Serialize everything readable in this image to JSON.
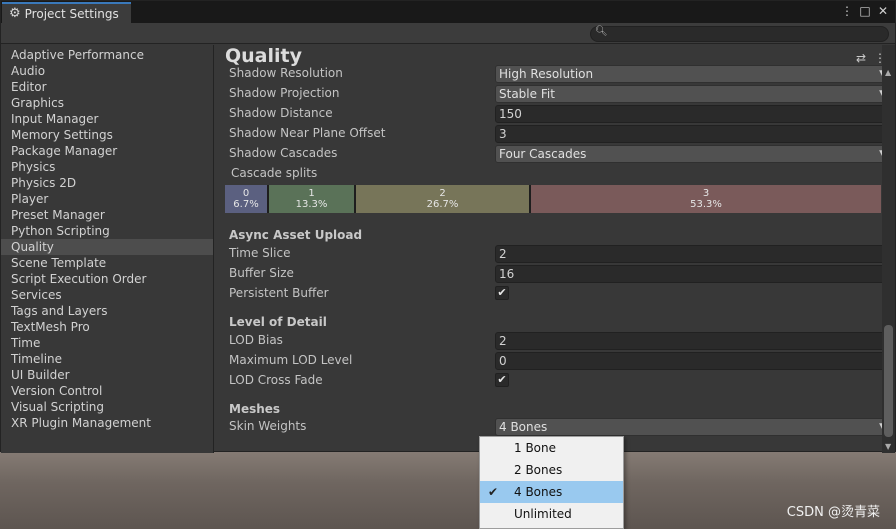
{
  "window": {
    "title": "Project Settings",
    "controls": [
      "⋮",
      "□",
      "✕"
    ]
  },
  "search": {
    "placeholder": ""
  },
  "sidebar": {
    "items": [
      {
        "label": "Adaptive Performance"
      },
      {
        "label": "Audio"
      },
      {
        "label": "Editor"
      },
      {
        "label": "Graphics"
      },
      {
        "label": "Input Manager"
      },
      {
        "label": "Memory Settings"
      },
      {
        "label": "Package Manager"
      },
      {
        "label": "Physics"
      },
      {
        "label": "Physics 2D"
      },
      {
        "label": "Player"
      },
      {
        "label": "Preset Manager"
      },
      {
        "label": "Python Scripting"
      },
      {
        "label": "Quality",
        "selected": true
      },
      {
        "label": "Scene Template"
      },
      {
        "label": "Script Execution Order"
      },
      {
        "label": "Services"
      },
      {
        "label": "Tags and Layers"
      },
      {
        "label": "TextMesh Pro"
      },
      {
        "label": "Time"
      },
      {
        "label": "Timeline"
      },
      {
        "label": "UI Builder"
      },
      {
        "label": "Version Control"
      },
      {
        "label": "Visual Scripting"
      },
      {
        "label": "XR Plugin Management"
      }
    ]
  },
  "page": {
    "title": "Quality",
    "shadows": {
      "resolution_label": "Shadow Resolution",
      "resolution_value": "High Resolution",
      "projection_label": "Shadow Projection",
      "projection_value": "Stable Fit",
      "distance_label": "Shadow Distance",
      "distance_value": "150",
      "near_plane_label": "Shadow Near Plane Offset",
      "near_plane_value": "3",
      "cascades_label": "Shadow Cascades",
      "cascades_value": "Four Cascades",
      "splits_label": "Cascade splits"
    },
    "cascade_splits": [
      {
        "index": "0",
        "percent": "6.7%",
        "fraction": 0.067,
        "color": "#5b6080"
      },
      {
        "index": "1",
        "percent": "13.3%",
        "fraction": 0.133,
        "color": "#5a7258"
      },
      {
        "index": "2",
        "percent": "26.7%",
        "fraction": 0.267,
        "color": "#777559"
      },
      {
        "index": "3",
        "percent": "53.3%",
        "fraction": 0.533,
        "color": "#7a5a5a"
      }
    ],
    "async": {
      "heading": "Async Asset Upload",
      "time_slice_label": "Time Slice",
      "time_slice_value": "2",
      "buffer_size_label": "Buffer Size",
      "buffer_size_value": "16",
      "persistent_label": "Persistent Buffer",
      "persistent_checked": true
    },
    "lod": {
      "heading": "Level of Detail",
      "bias_label": "LOD Bias",
      "bias_value": "2",
      "max_level_label": "Maximum LOD Level",
      "max_level_value": "0",
      "cross_fade_label": "LOD Cross Fade",
      "cross_fade_checked": true
    },
    "meshes": {
      "heading": "Meshes",
      "skin_weights_label": "Skin Weights",
      "skin_weights_value": "4 Bones"
    }
  },
  "popup": {
    "options": [
      {
        "label": "1 Bone",
        "checked": false
      },
      {
        "label": "2 Bones",
        "checked": false
      },
      {
        "label": "4 Bones",
        "checked": true
      },
      {
        "label": "Unlimited",
        "checked": false
      }
    ]
  },
  "watermark": "CSDN @烫青菜",
  "colors": {
    "tab_accent": "#3a79bb",
    "selected_item": "#4d4d4d",
    "popup_highlight": "#99c9ef"
  }
}
